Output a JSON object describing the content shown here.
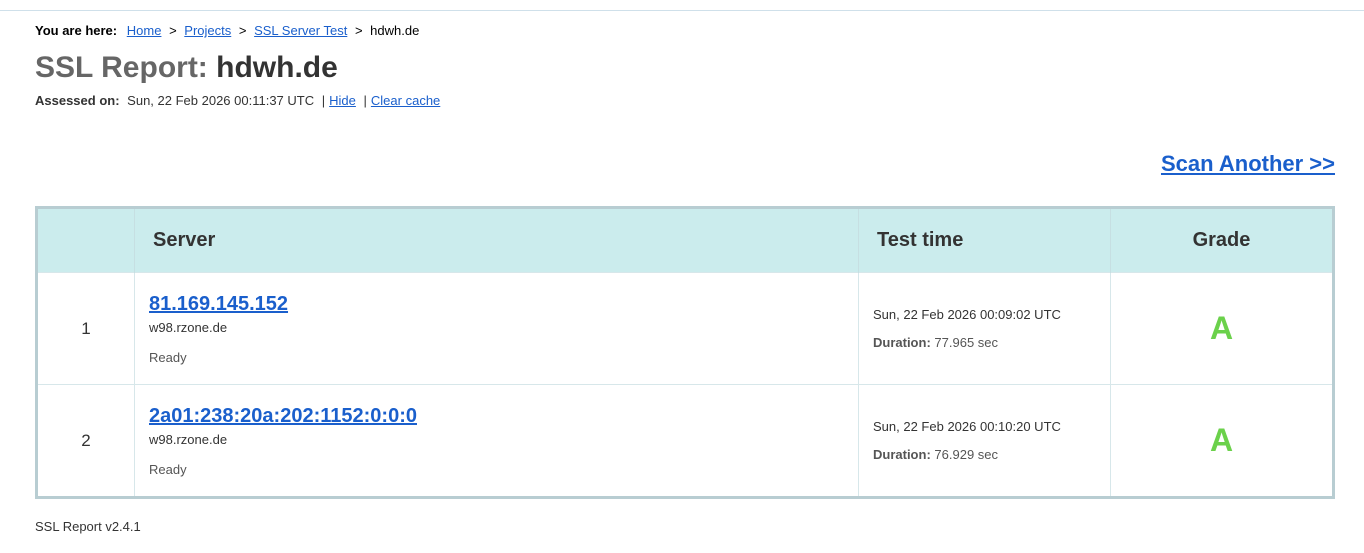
{
  "breadcrumb": {
    "label": "You are here:",
    "items": [
      "Home",
      "Projects",
      "SSL Server Test"
    ],
    "separator": ">",
    "current": "hdwh.de"
  },
  "title": {
    "prefix": "SSL Report:",
    "host": "hdwh.de"
  },
  "assessed": {
    "label": "Assessed on:",
    "value": "Sun, 22 Feb 2026 00:11:37 UTC",
    "separator": "|",
    "hide_label": "Hide",
    "clear_cache_label": "Clear cache"
  },
  "scan_another_label": "Scan Another >>",
  "table": {
    "headers": {
      "index": "",
      "server": "Server",
      "test_time": "Test time",
      "grade": "Grade"
    },
    "rows": [
      {
        "index": "1",
        "ip": "81.169.145.152",
        "hostname": "w98.rzone.de",
        "status": "Ready",
        "test_time": "Sun, 22 Feb 2026 00:09:02 UTC",
        "duration_label": "Duration:",
        "duration": "77.965 sec",
        "grade": "A"
      },
      {
        "index": "2",
        "ip": "2a01:238:20a:202:1152:0:0:0",
        "hostname": "w98.rzone.de",
        "status": "Ready",
        "test_time": "Sun, 22 Feb 2026 00:10:20 UTC",
        "duration_label": "Duration:",
        "duration": "76.929 sec",
        "grade": "A"
      }
    ]
  },
  "footer": "SSL Report v2.4.1",
  "colors": {
    "link": "#1a5fcc",
    "header_bg": "#cbeced",
    "grade_a": "#6bd14b",
    "table_border": "#b8cdd2"
  }
}
